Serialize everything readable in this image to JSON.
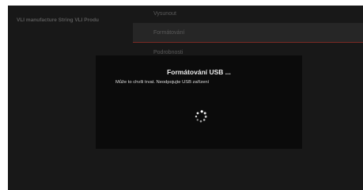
{
  "background": {
    "left_title": "VLI manufacture String VLI Produ",
    "menu": [
      {
        "label": "Vysunout"
      },
      {
        "label": "Formátování"
      },
      {
        "label": "Podrobnosti"
      }
    ],
    "accent_color": "#7a2a24"
  },
  "dialog": {
    "title": "Formátování USB ...",
    "message": "Může to chvíli trvat. Neodpojujte USB zařízení",
    "spinner_icon": "loading-spinner-icon"
  }
}
